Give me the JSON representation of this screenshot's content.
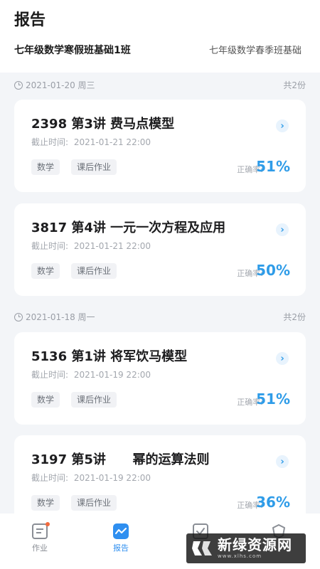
{
  "header": {
    "title": "报告",
    "tabs": [
      {
        "label": "七年级数学寒假班基础1班",
        "active": true
      },
      {
        "label": "七年级数学春季班基础",
        "active": false
      }
    ]
  },
  "groups": [
    {
      "date": "2021-01-20  周三",
      "count": "共2份",
      "cards": [
        {
          "title": "2398 第3讲 费马点模型",
          "deadline_label": "截止时间:",
          "deadline": "2021-01-21 22:00",
          "tags": [
            "数学",
            "课后作业"
          ],
          "accuracy_label": "正确率:",
          "accuracy": "51%"
        },
        {
          "title": "3817 第4讲 一元一次方程及应用",
          "deadline_label": "截止时间:",
          "deadline": "2021-01-21 22:00",
          "tags": [
            "数学",
            "课后作业"
          ],
          "accuracy_label": "正确率:",
          "accuracy": "50%"
        }
      ]
    },
    {
      "date": "2021-01-18  周一",
      "count": "共2份",
      "cards": [
        {
          "title": "5136 第1讲 将军饮马模型",
          "deadline_label": "截止时间:",
          "deadline": "2021-01-19 22:00",
          "tags": [
            "数学",
            "课后作业"
          ],
          "accuracy_label": "正确率:",
          "accuracy": "51%"
        },
        {
          "title": "3197 第5讲      幂的运算法则",
          "deadline_label": "截止时间:",
          "deadline": "2021-01-19 22:00",
          "tags": [
            "数学",
            "课后作业"
          ],
          "accuracy_label": "正确率:",
          "accuracy": "36%"
        }
      ]
    }
  ],
  "tabbar": {
    "items": [
      {
        "label": "作业",
        "icon": "homework-icon",
        "active": false,
        "badge": true
      },
      {
        "label": "报告",
        "icon": "report-icon",
        "active": true,
        "badge": false
      },
      {
        "label": "",
        "icon": "check-icon",
        "active": false,
        "badge": false
      },
      {
        "label": "",
        "icon": "shield-icon",
        "active": false,
        "badge": false
      }
    ]
  },
  "watermark": {
    "text": "新绿资源网",
    "sub": "www.xlhs.com"
  },
  "colors": {
    "accent": "#2f9ce8",
    "badge": "#f26a3d",
    "background": "#f3f5f8"
  }
}
